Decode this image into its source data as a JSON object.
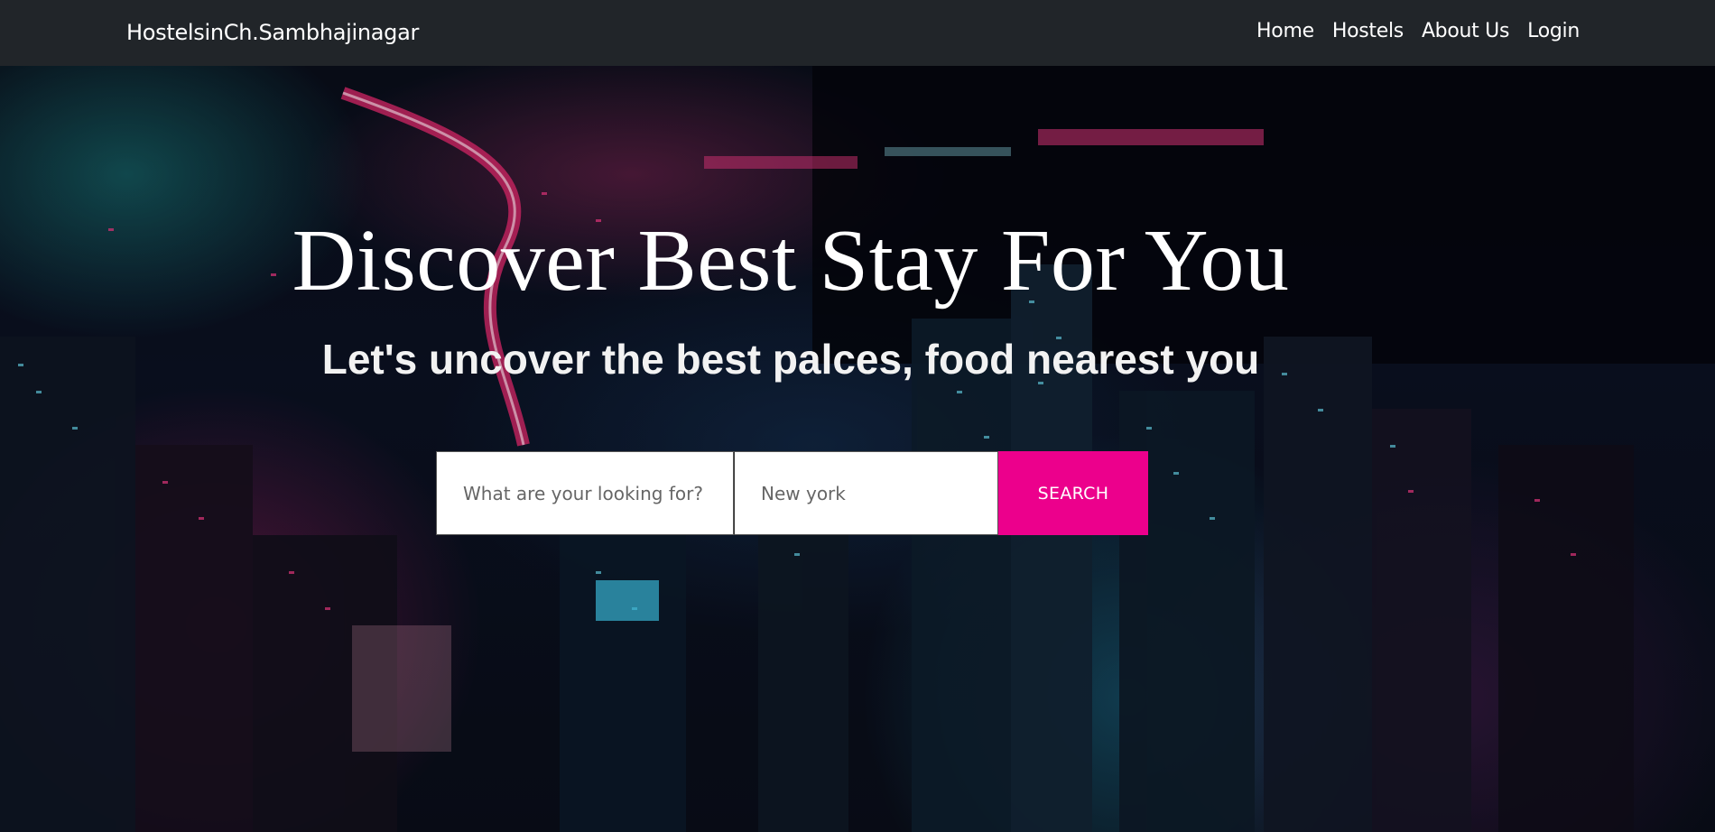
{
  "navbar": {
    "brand": "HostelsinCh.Sambhajinagar",
    "links": [
      {
        "label": "Home"
      },
      {
        "label": "Hostels"
      },
      {
        "label": "About Us"
      },
      {
        "label": "Login"
      }
    ]
  },
  "hero": {
    "title": "Discover Best Stay For You",
    "subtitle": "Let's uncover the best palces, food nearest you",
    "search": {
      "what_placeholder": "What are your looking for?",
      "where_placeholder": "New york",
      "button_label": "SEARCH"
    }
  },
  "colors": {
    "navbar_bg": "#212529",
    "accent": "#ec008c"
  }
}
